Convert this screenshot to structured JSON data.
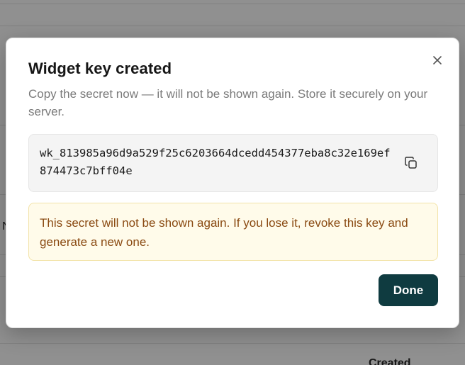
{
  "background": {
    "column_header": "Created",
    "row_fragment": "N"
  },
  "dialog": {
    "title": "Widget key created",
    "description": "Copy the secret now — it will not be shown again. Store it securely on your server.",
    "secret_key": "wk_813985a96d9a529f25c6203664dcedd454377eba8c32e169ef874473c7bff04e",
    "warning": "This secret will not be shown again. If you lose it, revoke this key and generate a new one.",
    "done_label": "Done",
    "close_icon": "close-icon",
    "copy_icon": "copy-icon"
  },
  "colors": {
    "primary_button": "#0f3b40",
    "warning_bg": "#fffbea",
    "warning_text": "#8a4a12"
  }
}
